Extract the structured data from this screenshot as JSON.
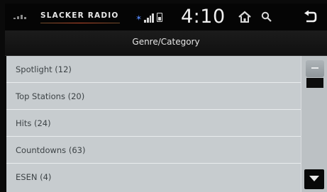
{
  "status_bar": {
    "brand": "SLACKER RADIO",
    "clock": "4:10",
    "icons": [
      "signal-icon",
      "bluetooth-icon",
      "cell-signal-icon",
      "battery-icon",
      "home-icon",
      "search-icon",
      "back-icon"
    ]
  },
  "header": {
    "title": "Genre/Category"
  },
  "list": {
    "items": [
      {
        "label": "Spotlight (12)"
      },
      {
        "label": "Top Stations (20)"
      },
      {
        "label": "Hits (24)"
      },
      {
        "label": "Countdowns (63)"
      },
      {
        "label": "ESEN (4)"
      }
    ]
  },
  "colors": {
    "list_bg": "#c7cccf",
    "text": "#3d4346",
    "header_bg": "#1c1c1c",
    "accent": "#c24a2a"
  }
}
